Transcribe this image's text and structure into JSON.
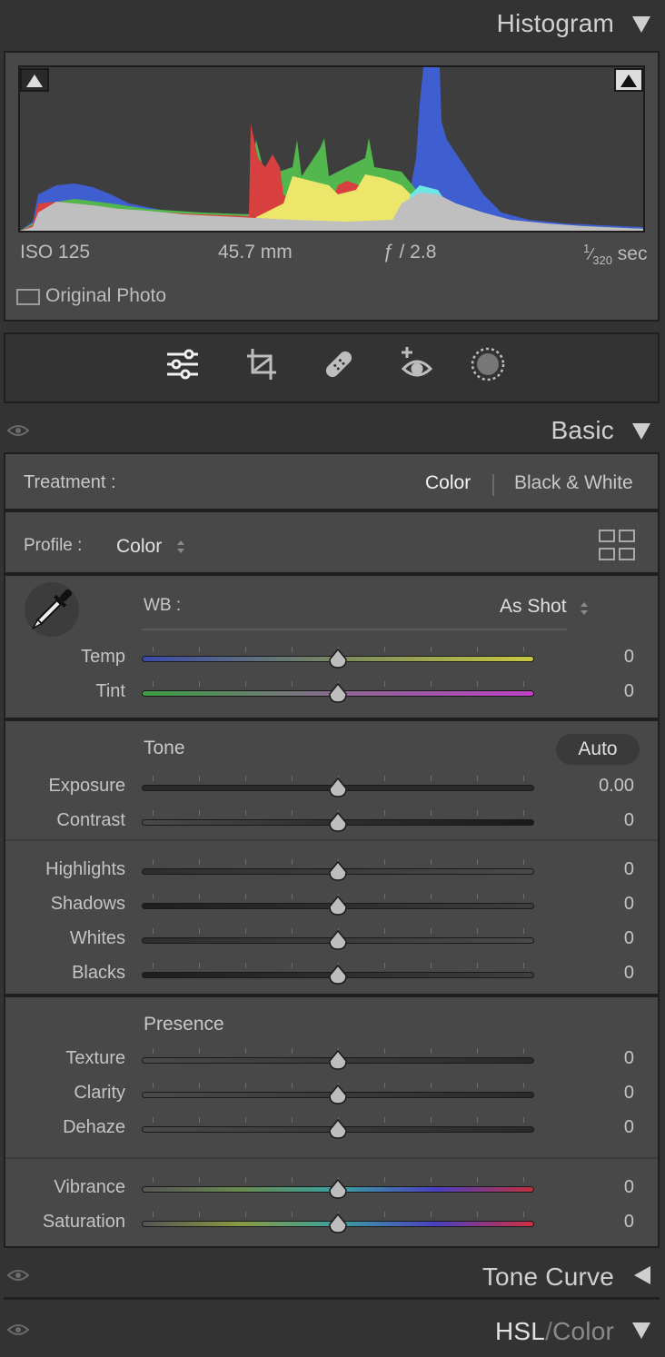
{
  "histogram": {
    "title": "Histogram",
    "iso": "ISO 125",
    "focal": "45.7 mm",
    "aperture": "ƒ / 2.8",
    "shutter_num": "1",
    "shutter_den": "320",
    "shutter_unit": "sec",
    "original_photo": "Original Photo"
  },
  "basic": {
    "title": "Basic",
    "treatment_label": "Treatment :",
    "treatment_color": "Color",
    "treatment_bw": "Black & White",
    "profile_label": "Profile :",
    "profile_value": "Color",
    "wb_label": "WB :",
    "wb_value": "As Shot",
    "tone_label": "Tone",
    "auto_label": "Auto",
    "presence_label": "Presence",
    "sliders": {
      "temp": {
        "label": "Temp",
        "value": "0"
      },
      "tint": {
        "label": "Tint",
        "value": "0"
      },
      "exposure": {
        "label": "Exposure",
        "value": "0.00"
      },
      "contrast": {
        "label": "Contrast",
        "value": "0"
      },
      "highlights": {
        "label": "Highlights",
        "value": "0"
      },
      "shadows": {
        "label": "Shadows",
        "value": "0"
      },
      "whites": {
        "label": "Whites",
        "value": "0"
      },
      "blacks": {
        "label": "Blacks",
        "value": "0"
      },
      "texture": {
        "label": "Texture",
        "value": "0"
      },
      "clarity": {
        "label": "Clarity",
        "value": "0"
      },
      "dehaze": {
        "label": "Dehaze",
        "value": "0"
      },
      "vibrance": {
        "label": "Vibrance",
        "value": "0"
      },
      "saturation": {
        "label": "Saturation",
        "value": "0"
      }
    }
  },
  "tone_curve": {
    "title": "Tone Curve"
  },
  "hsl": {
    "title_hsl": "HSL",
    "title_sep": "/",
    "title_color": "Color"
  },
  "colors": {
    "panel_bg": "#484848",
    "app_bg": "#333333",
    "histogram_blue": "#5b8ff0",
    "histogram_red": "#e04848",
    "histogram_green": "#58c058",
    "histogram_yellow": "#f0e858"
  },
  "icons": [
    "edit-sliders-icon",
    "crop-icon",
    "healing-icon",
    "red-eye-icon",
    "masking-icon",
    "eyedropper-icon",
    "profile-browser-icon",
    "eye-icon"
  ]
}
